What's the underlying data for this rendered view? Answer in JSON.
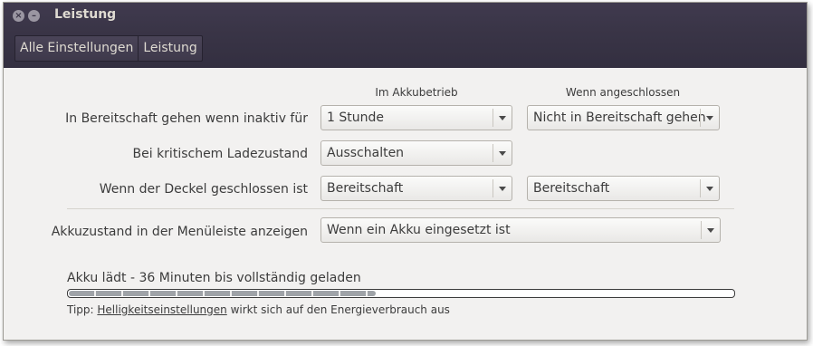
{
  "window": {
    "title": "Leistung"
  },
  "breadcrumb": [
    "Alle Einstellungen",
    "Leistung"
  ],
  "columns": {
    "battery": "Im Akkubetrieb",
    "plugged": "Wenn angeschlossen"
  },
  "rows": [
    {
      "label": "In Bereitschaft gehen wenn inaktiv für",
      "battery": "1 Stunde",
      "plugged": "Nicht in Bereitschaft gehen"
    },
    {
      "label": "Bei kritischem Ladezustand",
      "battery": "Ausschalten"
    },
    {
      "label": "Wenn der Deckel geschlossen ist",
      "battery": "Bereitschaft",
      "plugged": "Bereitschaft"
    }
  ],
  "menubar_row": {
    "label": "Akkuzustand in der Menüleiste anzeigen",
    "value": "Wenn ein Akku eingesetzt ist"
  },
  "battery_status": {
    "text": "Akku lädt - 36 Minuten bis vollständig geladen",
    "charge_fraction": 0.46
  },
  "tip": {
    "prefix": "Tipp: ",
    "link": "Helligkeitseinstellungen",
    "suffix": " wirkt sich auf den Energieverbrauch aus"
  }
}
